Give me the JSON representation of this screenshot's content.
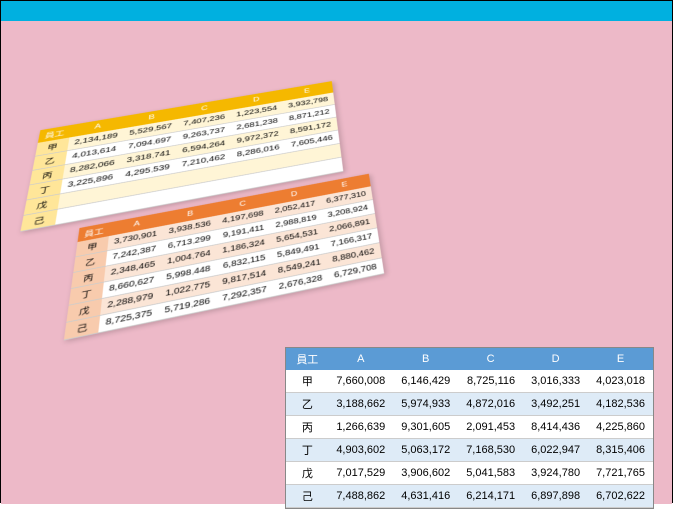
{
  "header1": "員工",
  "cols": [
    "A",
    "B",
    "C",
    "D",
    "E"
  ],
  "rowlabels": [
    "甲",
    "乙",
    "丙",
    "丁",
    "戊",
    "己"
  ],
  "chart_data": [
    {
      "type": "table",
      "title": "yellow",
      "categories": [
        "A",
        "B",
        "C",
        "D",
        "E"
      ],
      "series": [
        {
          "name": "甲",
          "values": [
            2134189,
            5529567,
            7407236,
            1223554,
            3932798
          ]
        },
        {
          "name": "乙",
          "values": [
            4013614,
            7094697,
            9263737,
            2681238,
            8871212
          ]
        },
        {
          "name": "丙",
          "values": [
            8282066,
            3318741,
            6594264,
            9972372,
            8591172
          ]
        },
        {
          "name": "丁",
          "values": [
            3225896,
            4295539,
            7210462,
            8286016,
            7605446
          ]
        },
        {
          "name": "戊",
          "values": [
            null,
            null,
            null,
            null,
            null
          ]
        },
        {
          "name": "己",
          "values": [
            null,
            null,
            null,
            null,
            null
          ]
        }
      ]
    },
    {
      "type": "table",
      "title": "orange",
      "categories": [
        "A",
        "B",
        "C",
        "D",
        "E"
      ],
      "series": [
        {
          "name": "甲",
          "values": [
            3730901,
            3938536,
            4197698,
            2052417,
            6377310
          ]
        },
        {
          "name": "乙",
          "values": [
            7242387,
            6713299,
            9191411,
            2988819,
            3208924
          ]
        },
        {
          "name": "丙",
          "values": [
            2348465,
            1004764,
            1186324,
            5654531,
            2066891
          ]
        },
        {
          "name": "丁",
          "values": [
            8660627,
            5998448,
            6832115,
            5849491,
            7166317
          ]
        },
        {
          "name": "戊",
          "values": [
            2288979,
            1022775,
            9817514,
            8549241,
            8880462
          ]
        },
        {
          "name": "己",
          "values": [
            8725375,
            5719286,
            7292357,
            2676328,
            6729708
          ]
        }
      ]
    },
    {
      "type": "table",
      "title": "blue",
      "categories": [
        "A",
        "B",
        "C",
        "D",
        "E"
      ],
      "series": [
        {
          "name": "甲",
          "values": [
            7660008,
            6146429,
            8725116,
            3016333,
            4023018
          ]
        },
        {
          "name": "乙",
          "values": [
            3188662,
            5974933,
            4872016,
            3492251,
            4182536
          ]
        },
        {
          "name": "丙",
          "values": [
            1266639,
            9301605,
            2091453,
            8414436,
            4225860
          ]
        },
        {
          "name": "丁",
          "values": [
            4903602,
            5063172,
            7168530,
            6022947,
            8315406
          ]
        },
        {
          "name": "戊",
          "values": [
            7017529,
            3906602,
            5041583,
            3924780,
            7721765
          ]
        },
        {
          "name": "己",
          "values": [
            7488862,
            4631416,
            6214171,
            6897898,
            6702622
          ]
        }
      ]
    }
  ]
}
